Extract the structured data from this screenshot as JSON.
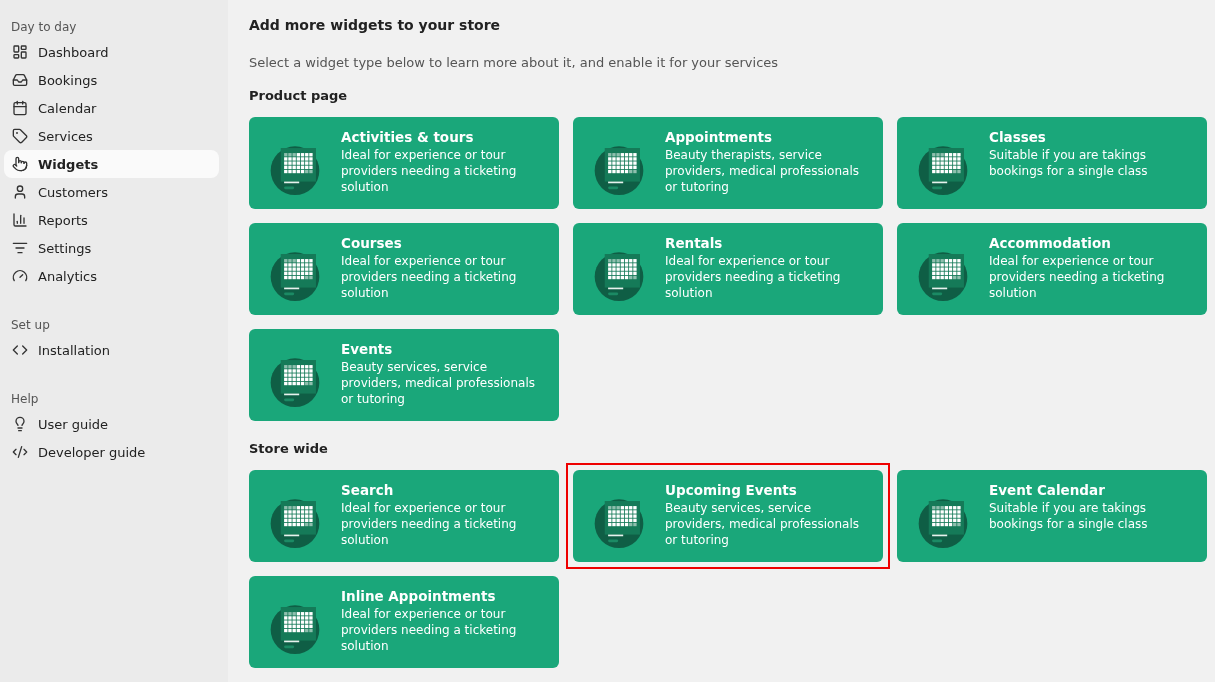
{
  "sidebar": {
    "sections": [
      {
        "title": "Day to day",
        "items": [
          {
            "label": "Dashboard",
            "selected": false
          },
          {
            "label": "Bookings",
            "selected": false
          },
          {
            "label": "Calendar",
            "selected": false
          },
          {
            "label": "Services",
            "selected": false
          },
          {
            "label": "Widgets",
            "selected": true
          },
          {
            "label": "Customers",
            "selected": false
          },
          {
            "label": "Reports",
            "selected": false
          },
          {
            "label": "Settings",
            "selected": false
          },
          {
            "label": "Analytics",
            "selected": false
          }
        ]
      },
      {
        "title": "Set up",
        "items": [
          {
            "label": "Installation",
            "selected": false
          }
        ]
      },
      {
        "title": "Help",
        "items": [
          {
            "label": "User guide",
            "selected": false
          },
          {
            "label": "Developer guide",
            "selected": false
          }
        ]
      }
    ]
  },
  "main": {
    "title": "Add more widgets to your store",
    "subtitle": "Select a widget type below to learn more about it, and enable it for your services",
    "groups": [
      {
        "title": "Product page",
        "widgets": [
          {
            "title": "Activities & tours",
            "description": "Ideal for experience or tour providers needing a ticketing solution",
            "highlighted": false
          },
          {
            "title": "Appointments",
            "description": "Beauty therapists, service providers, medical professionals or tutoring",
            "highlighted": false
          },
          {
            "title": "Classes",
            "description": "Suitable if you are takings bookings for a single class",
            "highlighted": false
          },
          {
            "title": "Courses",
            "description": "Ideal for experience or tour providers needing a ticketing solution",
            "highlighted": false
          },
          {
            "title": "Rentals",
            "description": "Ideal for experience or tour providers needing a ticketing solution",
            "highlighted": false
          },
          {
            "title": "Accommodation",
            "description": "Ideal for experience or tour providers needing a ticketing solution",
            "highlighted": false
          },
          {
            "title": "Events",
            "description": "Beauty services, service providers, medical professionals or tutoring",
            "highlighted": false
          }
        ]
      },
      {
        "title": "Store wide",
        "widgets": [
          {
            "title": "Search",
            "description": "Ideal for experience or tour providers needing a ticketing solution",
            "highlighted": false
          },
          {
            "title": "Upcoming Events",
            "description": "Beauty services, service providers, medical professionals or tutoring",
            "highlighted": true
          },
          {
            "title": "Event Calendar",
            "description": "Suitable if you are takings bookings for a single class",
            "highlighted": false
          },
          {
            "title": "Inline Appointments",
            "description": "Ideal for experience or tour providers needing a ticketing solution",
            "highlighted": false
          }
        ]
      }
    ]
  }
}
